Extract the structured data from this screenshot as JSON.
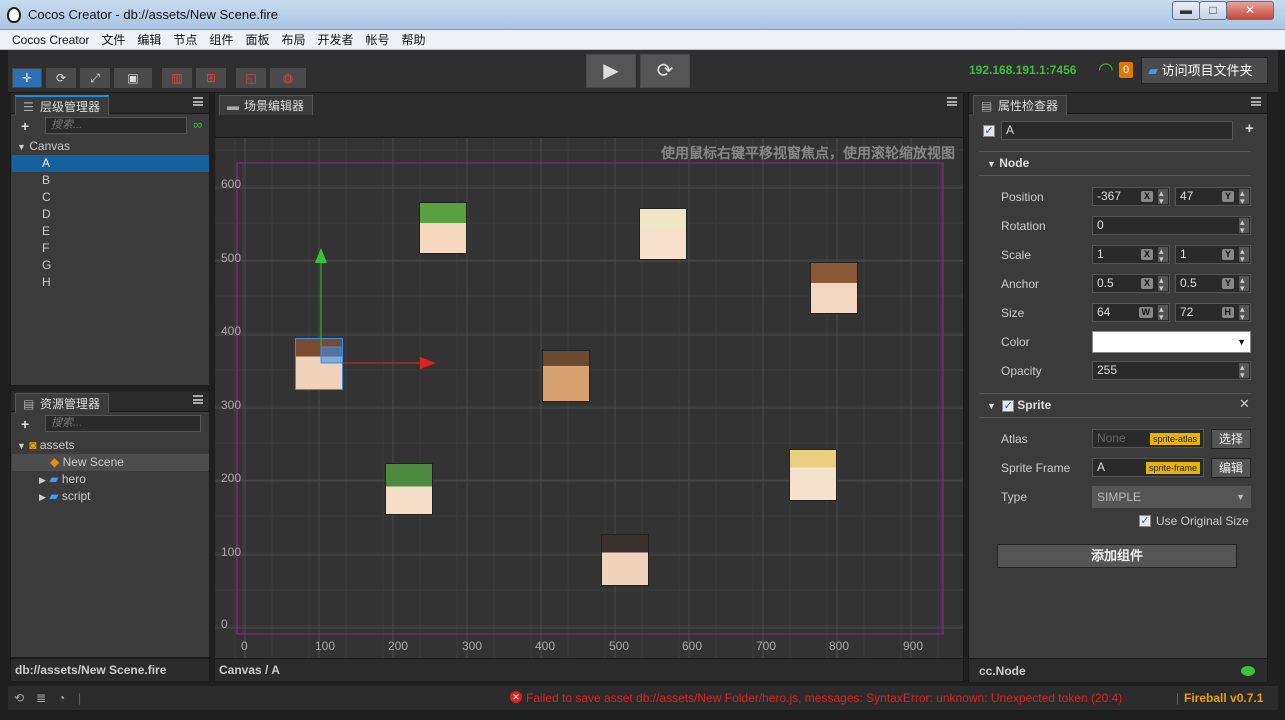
{
  "window": {
    "title": "Cocos Creator - db://assets/New Scene.fire",
    "min": "▬",
    "max": "□",
    "close": "✕"
  },
  "menu": [
    "Cocos Creator",
    "文件",
    "编辑",
    "节点",
    "组件",
    "面板",
    "布局",
    "开发者",
    "帐号",
    "帮助"
  ],
  "toolbar": {
    "ip": "192.168.191.1:7456",
    "badge": "0",
    "open_project": "访问项目文件夹"
  },
  "hierarchy": {
    "title": "层级管理器",
    "search": "搜索...",
    "root": "Canvas",
    "items": [
      "A",
      "B",
      "C",
      "D",
      "E",
      "F",
      "G",
      "H"
    ],
    "selected": "A",
    "footer": "db://assets/New Scene.fire"
  },
  "assets": {
    "title": "资源管理器",
    "search": "搜索...",
    "root": "assets",
    "items": [
      "New Scene",
      "hero",
      "script"
    ]
  },
  "scene": {
    "title": "场景编辑器",
    "hint": "使用鼠标右键平移视窗焦点，使用滚轮缩放视图",
    "y_ticks": [
      "600",
      "500",
      "400",
      "300",
      "200",
      "100",
      "0"
    ],
    "x_ticks": [
      "0",
      "100",
      "200",
      "300",
      "400",
      "500",
      "600",
      "700",
      "800",
      "900"
    ],
    "footer": "Canvas / A"
  },
  "inspector": {
    "title": "属性检查器",
    "node_name": "A",
    "node_section": "Node",
    "position": {
      "label": "Position",
      "x": "-367",
      "y": "47"
    },
    "rotation": {
      "label": "Rotation",
      "value": "0"
    },
    "scale": {
      "label": "Scale",
      "x": "1",
      "y": "1"
    },
    "anchor": {
      "label": "Anchor",
      "x": "0.5",
      "y": "0.5"
    },
    "size": {
      "label": "Size",
      "w": "64",
      "h": "72"
    },
    "color": {
      "label": "Color",
      "value": "#ffffff"
    },
    "opacity": {
      "label": "Opacity",
      "value": "255"
    },
    "sprite_section": "Sprite",
    "atlas": {
      "label": "Atlas",
      "value": "None",
      "tag": "sprite-atlas",
      "btn": "选择"
    },
    "sprite_frame": {
      "label": "Sprite Frame",
      "value": "A",
      "tag": "sprite-frame",
      "btn": "编辑"
    },
    "type": {
      "label": "Type",
      "value": "SIMPLE"
    },
    "use_original_size": "Use Original Size",
    "add_component": "添加组件",
    "footer": "cc.Node",
    "axis": {
      "x": "X",
      "y": "Y",
      "w": "W",
      "h": "H"
    }
  },
  "status": {
    "error": "Failed to save asset db://assets/New Folder/hero.js, messages: SyntaxError: unknown: Unexpected token (20:4)",
    "version": "Fireball v0.7.1"
  },
  "colors": {
    "accent": "#2c6fb5",
    "error": "#e02020",
    "ip": "#35c435",
    "version": "#e8a000"
  }
}
